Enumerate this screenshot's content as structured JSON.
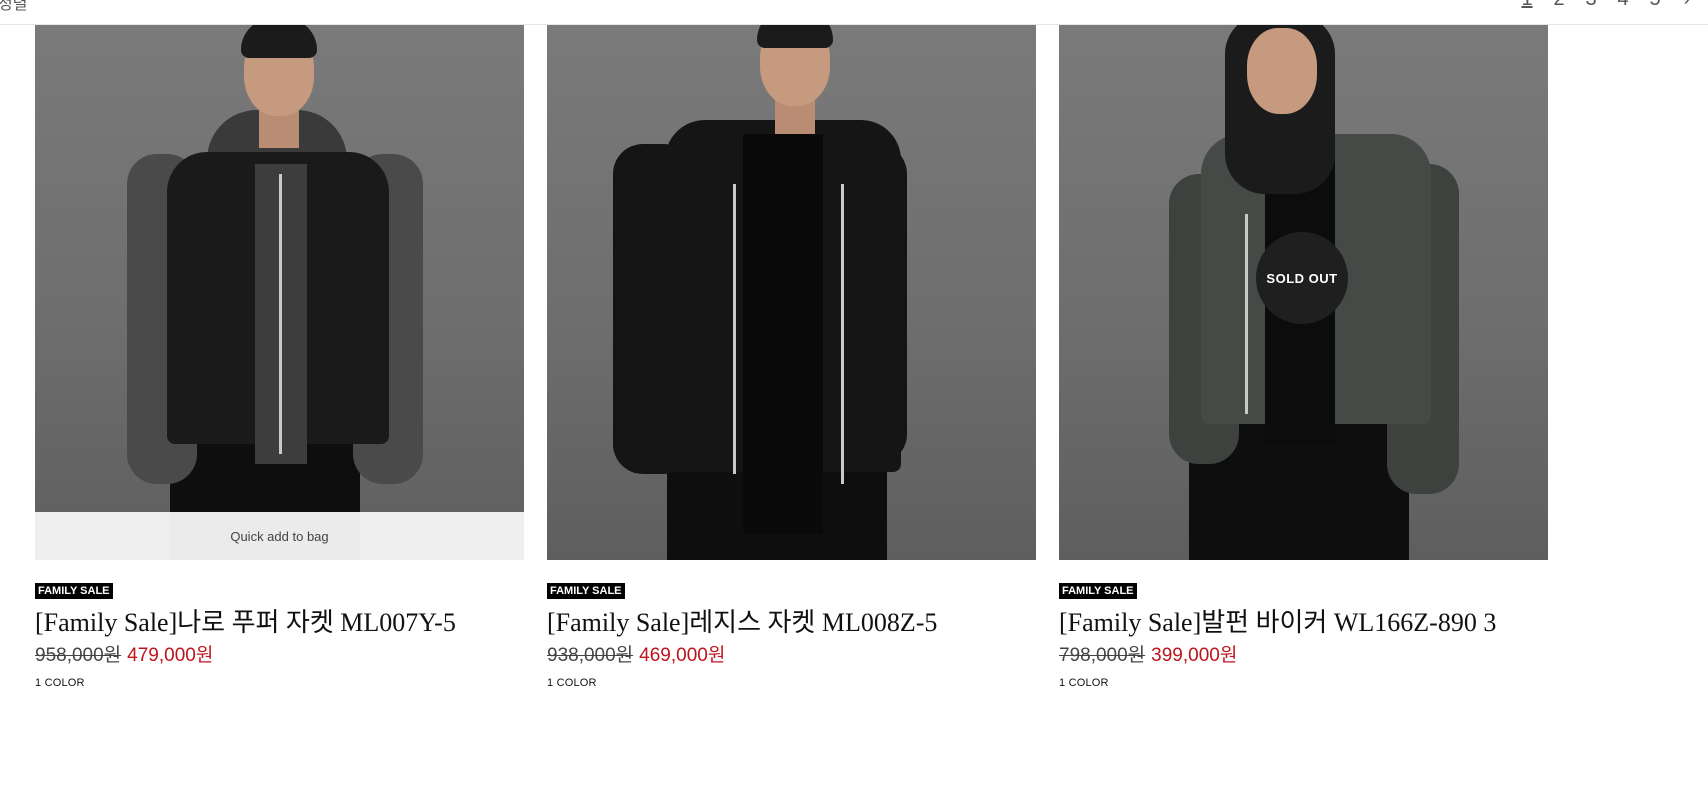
{
  "top": {
    "left_fragment": "정렬",
    "pages": [
      "1",
      "2",
      "3",
      "4",
      "5"
    ],
    "next_arrow": "›"
  },
  "products": [
    {
      "badge": "FAMILY SALE",
      "title": "[Family Sale]나로 푸퍼 자켓 ML007Y-5",
      "old_price": "958,000원",
      "new_price": "479,000원",
      "colors": "1 COLOR",
      "quick_add": "Quick add to bag"
    },
    {
      "badge": "FAMILY SALE",
      "title": "[Family Sale]레지스 자켓 ML008Z-5",
      "old_price": "938,000원",
      "new_price": "469,000원",
      "colors": "1 COLOR"
    },
    {
      "badge": "FAMILY SALE",
      "title": "[Family Sale]발펀 바이커 WL166Z-890 3",
      "old_price": "798,000원",
      "new_price": "399,000원",
      "colors": "1 COLOR",
      "sold_out": "SOLD OUT"
    }
  ],
  "colors": {
    "sale_red": "#c0141b",
    "badge_bg": "#000000",
    "photo_bg": "#747474"
  }
}
